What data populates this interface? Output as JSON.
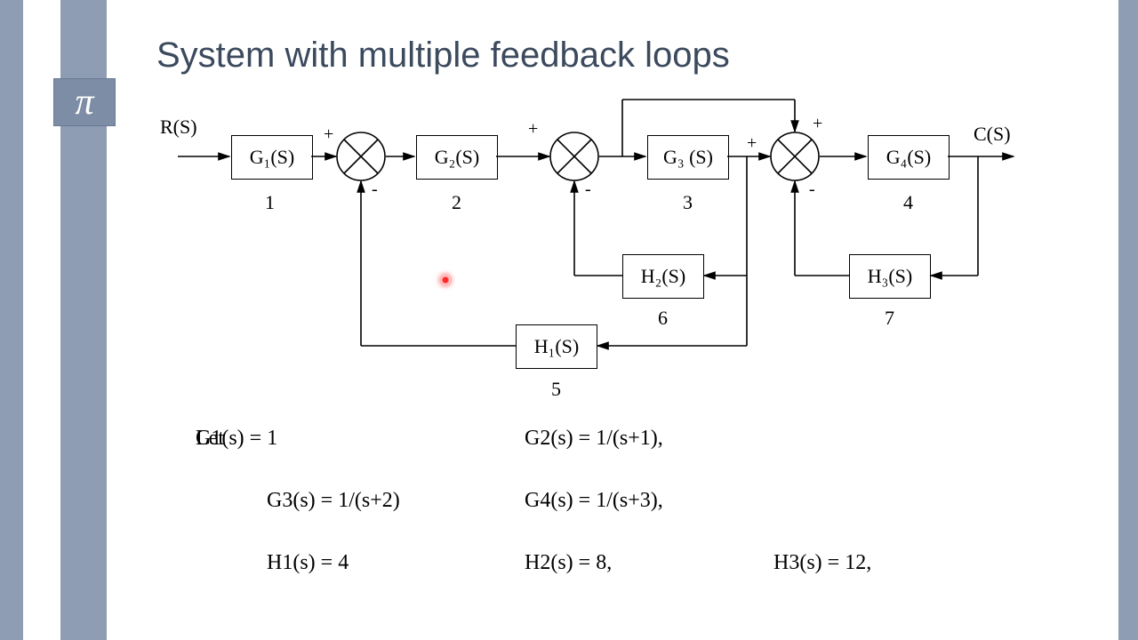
{
  "title": "System with multiple feedback loops",
  "pi": "π",
  "input_label": "R(S)",
  "output_label": "C(S)",
  "blocks": {
    "g1": "G₁(S)",
    "g2": "G₂(S)",
    "g3": "G₃ (S)",
    "g4": "G₄(S)",
    "h1": "H₁(S)",
    "h2": "H₂(S)",
    "h3": "H₃(S)"
  },
  "block_numbers": [
    "1",
    "2",
    "3",
    "4",
    "5",
    "6",
    "7"
  ],
  "signs": {
    "s1_top_plus": "+",
    "s1_bot_minus": "-",
    "s2_top_plus": "+",
    "s2_bot_minus": "-",
    "s3_left_plus": "+",
    "s3_top_plus": "+",
    "s3_bot_minus": "-"
  },
  "equations": {
    "let": "Let",
    "g1": "G1(s) = 1",
    "g2": "G2(s) = 1/(s+1),",
    "g3": "G3(s) = 1/(s+2)",
    "g4": "G4(s) = 1/(s+3),",
    "h1": "H1(s) = 4",
    "h2": "H2(s) = 8,",
    "h3": "H3(s) = 12,"
  }
}
